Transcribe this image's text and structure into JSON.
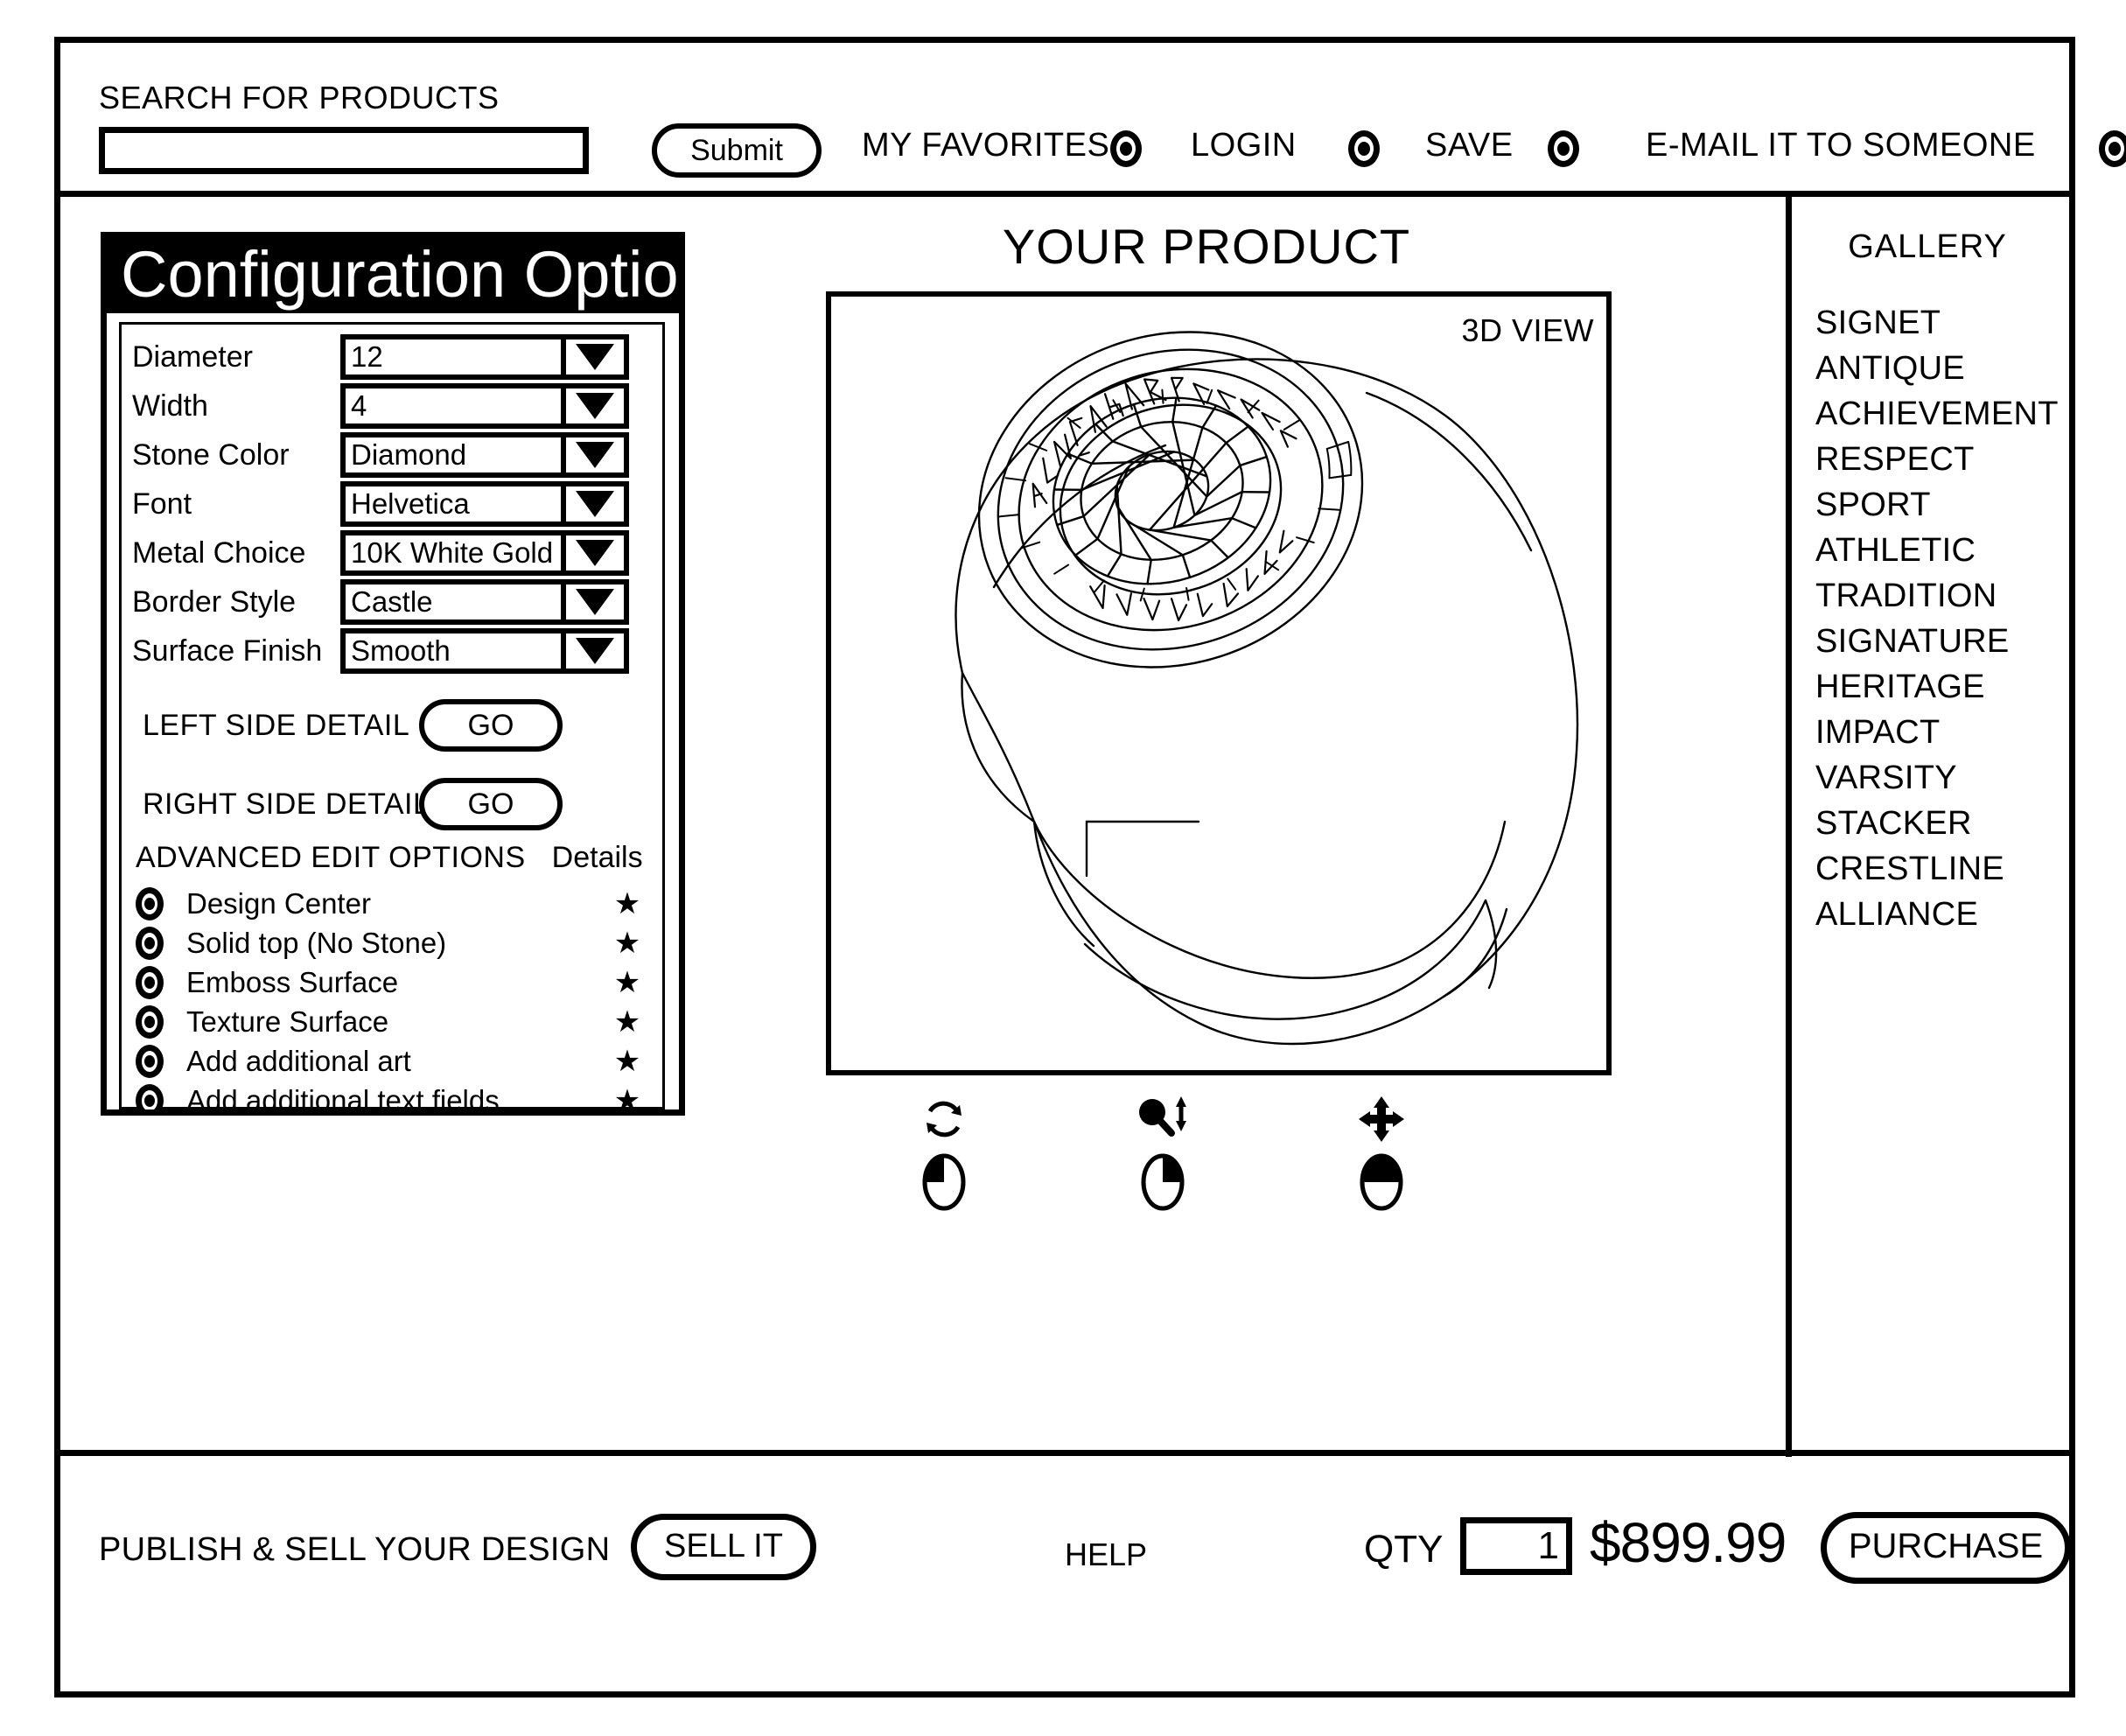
{
  "topbar": {
    "search_label": "SEARCH FOR PRODUCTS",
    "search_value": "",
    "search_placeholder": "",
    "submit_label": "Submit",
    "links": [
      {
        "label": "MY FAVORITES",
        "icon": "radio-icon"
      },
      {
        "label": "LOGIN",
        "icon": "radio-icon"
      },
      {
        "label": "SAVE",
        "icon": "radio-icon"
      },
      {
        "label": "E-MAIL IT TO SOMEONE",
        "icon": "radio-icon"
      }
    ]
  },
  "config": {
    "title": "Configuration Options",
    "fields": [
      {
        "label": "Diameter",
        "value": "12"
      },
      {
        "label": "Width",
        "value": "4"
      },
      {
        "label": "Stone Color",
        "value": "Diamond"
      },
      {
        "label": "Font",
        "value": "Helvetica"
      },
      {
        "label": "Metal Choice",
        "value": "10K White Gold"
      },
      {
        "label": "Border Style",
        "value": "Castle"
      },
      {
        "label": "Surface Finish",
        "value": "Smooth"
      }
    ],
    "side_details": [
      {
        "label": "LEFT SIDE DETAIL",
        "button": "GO"
      },
      {
        "label": "RIGHT SIDE DETAIL",
        "button": "GO"
      }
    ],
    "advanced": {
      "title": "ADVANCED EDIT OPTIONS",
      "details_header": "Details",
      "options": [
        {
          "label": "Design Center",
          "star": "★"
        },
        {
          "label": "Solid top (No Stone)",
          "star": "★"
        },
        {
          "label": "Emboss Surface",
          "star": "★"
        },
        {
          "label": "Texture Surface",
          "star": "★"
        },
        {
          "label": "Add additional art",
          "star": "★"
        },
        {
          "label": "Add additional text fields",
          "star": "★"
        }
      ]
    }
  },
  "product": {
    "title": "YOUR PRODUCT",
    "view_mode": "3D VIEW",
    "controls": [
      {
        "name": "rotate",
        "icon": "rotate-icon",
        "mouse": "left-button"
      },
      {
        "name": "zoom",
        "icon": "zoom-icon",
        "mouse": "right-button"
      },
      {
        "name": "pan",
        "icon": "pan-move-icon",
        "mouse": "both-buttons"
      }
    ]
  },
  "gallery": {
    "title": "GALLERY",
    "items": [
      "SIGNET",
      "ANTIQUE",
      "ACHIEVEMENT",
      "RESPECT",
      "SPORT",
      "ATHLETIC",
      "TRADITION",
      "SIGNATURE",
      "HERITAGE",
      "IMPACT",
      "VARSITY",
      "STACKER",
      "CRESTLINE",
      "ALLIANCE"
    ]
  },
  "bottombar": {
    "publish_label": "PUBLISH & SELL YOUR DESIGN",
    "sell_label": "SELL IT",
    "help_label": "HELP",
    "qty_label": "QTY",
    "qty_value": "1",
    "price": "$899.99",
    "purchase_label": "PURCHASE"
  },
  "colors": {
    "ink": "#000000",
    "paper": "#ffffff"
  }
}
